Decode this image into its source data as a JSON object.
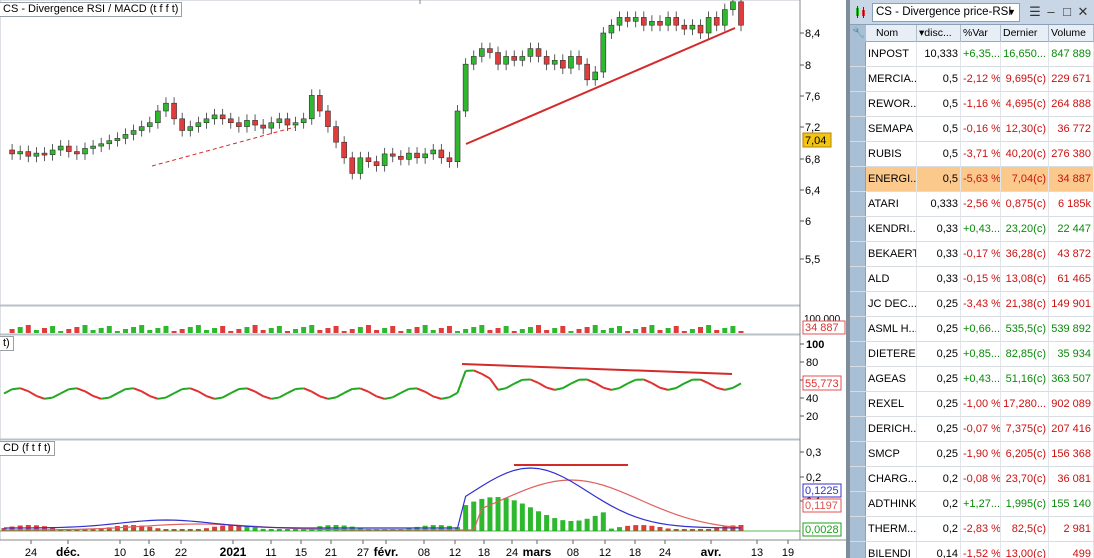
{
  "chart": {
    "price_title": "CS - Divergence RSI / MACD (t f f t)",
    "rsi_title": "t)",
    "macd_title": "CD (f t f t)",
    "price_axis_ticks": [
      "8,4",
      "8",
      "7,6",
      "7,2",
      "6,8",
      "6,4",
      "6",
      "5,5"
    ],
    "price_last": "7,04",
    "volume_axis_tick": "100 000",
    "volume_last": "34 887",
    "rsi_axis_ticks": [
      "100",
      "80",
      "60",
      "40",
      "20"
    ],
    "rsi_last": "55,773",
    "macd_axis_ticks": [
      "0,3",
      "0,2",
      "0,1"
    ],
    "macd_values": [
      "0,1225",
      "0,1197",
      "0,0028"
    ],
    "x_labels": [
      "24",
      "déc.",
      "10",
      "16",
      "22",
      "2021",
      "11",
      "15",
      "21",
      "27",
      "févr.",
      "08",
      "12",
      "18",
      "24",
      "mars",
      "08",
      "12",
      "18",
      "24",
      "avr.",
      "13",
      "19"
    ],
    "colors": {
      "up": "#2eb82e",
      "down": "#e03c3c",
      "divergence": "#d42a2a",
      "rsi_up": "#22a822",
      "rsi_down": "#e03030",
      "macd_line": "#3030d0",
      "signal_line": "#e06060"
    }
  },
  "list": {
    "title": "CS - Divergence price-RSI",
    "headers": [
      "Nom",
      "disc...",
      "%Var",
      "Dernier",
      "Volume"
    ],
    "rows": [
      {
        "nom": "INPOST",
        "disc": "10,333",
        "var": "+6,35...",
        "last": "16,650...",
        "vol": "847 889",
        "dir": "pos"
      },
      {
        "nom": "MERCIA...",
        "disc": "0,5",
        "var": "-2,12 %",
        "last": "9,695(c)",
        "vol": "229 671",
        "dir": "neg"
      },
      {
        "nom": "REWOR...",
        "disc": "0,5",
        "var": "-1,16 %",
        "last": "4,695(c)",
        "vol": "264 888",
        "dir": "neg"
      },
      {
        "nom": "SEMAPA",
        "disc": "0,5",
        "var": "-0,16 %",
        "last": "12,30(c)",
        "vol": "36 772",
        "dir": "neg"
      },
      {
        "nom": "RUBIS",
        "disc": "0,5",
        "var": "-3,71 %",
        "last": "40,20(c)",
        "vol": "276 380",
        "dir": "neg"
      },
      {
        "nom": "ENERGI...",
        "disc": "0,5",
        "var": "-5,63 %",
        "last": "7,04(c)",
        "vol": "34 887",
        "dir": "neg",
        "selected": true
      },
      {
        "nom": "ATARI",
        "disc": "0,333",
        "var": "-2,56 %",
        "last": "0,875(c)",
        "vol": "6 185k",
        "dir": "neg"
      },
      {
        "nom": "KENDRI...",
        "disc": "0,33",
        "var": "+0,43...",
        "last": "23,20(c)",
        "vol": "22 447",
        "dir": "pos"
      },
      {
        "nom": "BEKAERT",
        "disc": "0,33",
        "var": "-0,17 %",
        "last": "36,28(c)",
        "vol": "43 872",
        "dir": "neg"
      },
      {
        "nom": "ALD",
        "disc": "0,33",
        "var": "-0,15 %",
        "last": "13,08(c)",
        "vol": "61 465",
        "dir": "neg"
      },
      {
        "nom": "JC DEC...",
        "disc": "0,25",
        "var": "-3,43 %",
        "last": "21,38(c)",
        "vol": "149 901",
        "dir": "neg"
      },
      {
        "nom": "ASML H...",
        "disc": "0,25",
        "var": "+0,66...",
        "last": "535,5(c)",
        "vol": "539 892",
        "dir": "pos"
      },
      {
        "nom": "DIETEREN",
        "disc": "0,25",
        "var": "+0,85...",
        "last": "82,85(c)",
        "vol": "35 934",
        "dir": "pos"
      },
      {
        "nom": "AGEAS",
        "disc": "0,25",
        "var": "+0,43...",
        "last": "51,16(c)",
        "vol": "363 507",
        "dir": "pos"
      },
      {
        "nom": "REXEL",
        "disc": "0,25",
        "var": "-1,00 %",
        "last": "17,280...",
        "vol": "902 089",
        "dir": "neg"
      },
      {
        "nom": "DERICH...",
        "disc": "0,25",
        "var": "-0,07 %",
        "last": "7,375(c)",
        "vol": "207 416",
        "dir": "neg"
      },
      {
        "nom": "SMCP",
        "disc": "0,25",
        "var": "-1,90 %",
        "last": "6,205(c)",
        "vol": "156 368",
        "dir": "neg"
      },
      {
        "nom": "CHARG...",
        "disc": "0,2",
        "var": "-0,08 %",
        "last": "23,70(c)",
        "vol": "36 081",
        "dir": "neg"
      },
      {
        "nom": "ADTHINK",
        "disc": "0,2",
        "var": "+1,27...",
        "last": "1,995(c)",
        "vol": "155 140",
        "dir": "pos"
      },
      {
        "nom": "THERM...",
        "disc": "0,2",
        "var": "-2,83 %",
        "last": "82,5(c)",
        "vol": "2 981",
        "dir": "neg"
      },
      {
        "nom": "BILENDI",
        "disc": "0,14",
        "var": "-1,52 %",
        "last": "13,00(c)",
        "vol": "499",
        "dir": "neg"
      }
    ]
  }
}
